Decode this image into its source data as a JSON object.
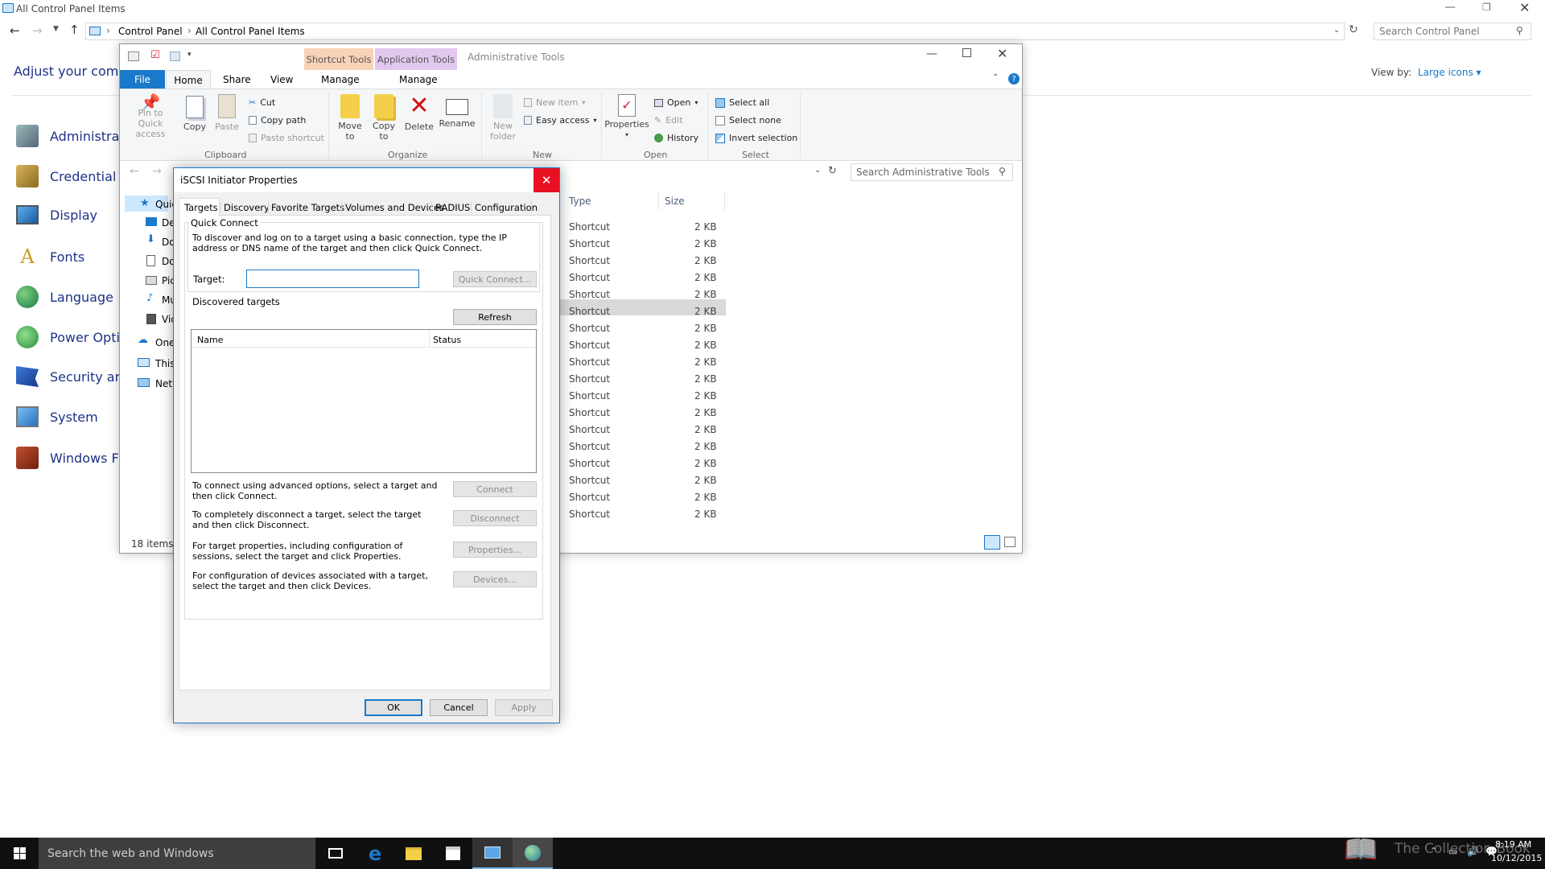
{
  "control_panel": {
    "title": "All Control Panel Items",
    "breadcrumb": [
      "Control Panel",
      "All Control Panel Items"
    ],
    "search_placeholder": "Search Control Panel",
    "adjust_text": "Adjust your compu",
    "view_by_label": "View by:",
    "view_by_value": "Large icons",
    "items": [
      "Administrati",
      "Credential M",
      "Display",
      "Fonts",
      "Language",
      "Power Optio",
      "Security and",
      "System",
      "Windows Fir"
    ]
  },
  "explorer": {
    "ctx_tabs": {
      "shortcut_tools": "Shortcut Tools",
      "application_tools": "Application Tools"
    },
    "window_title": "Administrative Tools",
    "menu_tabs": {
      "file": "File",
      "home": "Home",
      "share": "Share",
      "view": "View",
      "manage1": "Manage",
      "manage2": "Manage"
    },
    "ribbon": {
      "pin": "Pin to Quick access",
      "copy": "Copy",
      "paste": "Paste",
      "cut": "Cut",
      "copy_path": "Copy path",
      "paste_shortcut": "Paste shortcut",
      "clipboard": "Clipboard",
      "move_to": "Move to",
      "copy_to": "Copy to",
      "delete": "Delete",
      "rename": "Rename",
      "organize": "Organize",
      "new_folder": "New folder",
      "new_item": "New item",
      "easy_access": "Easy access",
      "new": "New",
      "properties": "Properties",
      "open": "Open",
      "edit": "Edit",
      "history": "History",
      "open_group": "Open",
      "select_all": "Select all",
      "select_none": "Select none",
      "invert_selection": "Invert selection",
      "select_group": "Select"
    },
    "search_placeholder": "Search Administrative Tools",
    "nav_items": [
      "Quic",
      "De",
      "Do",
      "Do",
      "Pic",
      "Mu",
      "Vic",
      "One",
      "This",
      "Netw"
    ],
    "columns": {
      "type": "Type",
      "size": "Size"
    },
    "rows": [
      {
        "type": "Shortcut",
        "size": "2 KB"
      },
      {
        "type": "Shortcut",
        "size": "2 KB"
      },
      {
        "type": "Shortcut",
        "size": "2 KB"
      },
      {
        "type": "Shortcut",
        "size": "2 KB"
      },
      {
        "type": "Shortcut",
        "size": "2 KB"
      },
      {
        "type": "Shortcut",
        "size": "2 KB"
      },
      {
        "type": "Shortcut",
        "size": "2 KB"
      },
      {
        "type": "Shortcut",
        "size": "2 KB"
      },
      {
        "type": "Shortcut",
        "size": "2 KB"
      },
      {
        "type": "Shortcut",
        "size": "2 KB"
      },
      {
        "type": "Shortcut",
        "size": "2 KB"
      },
      {
        "type": "Shortcut",
        "size": "2 KB"
      },
      {
        "type": "Shortcut",
        "size": "2 KB"
      },
      {
        "type": "Shortcut",
        "size": "2 KB"
      },
      {
        "type": "Shortcut",
        "size": "2 KB"
      },
      {
        "type": "Shortcut",
        "size": "2 KB"
      },
      {
        "type": "Shortcut",
        "size": "2 KB"
      },
      {
        "type": "Shortcut",
        "size": "2 KB"
      }
    ],
    "status": "18 items"
  },
  "dialog": {
    "title": "iSCSI Initiator Properties",
    "tabs": [
      "Targets",
      "Discovery",
      "Favorite Targets",
      "Volumes and Devices",
      "RADIUS",
      "Configuration"
    ],
    "quick_connect_label": "Quick Connect",
    "quick_connect_desc": "To discover and log on to a target using a basic connection, type the IP address or DNS name of the target and then click Quick Connect.",
    "target_label": "Target:",
    "target_value": "",
    "quick_connect_button": "Quick Connect...",
    "discovered_label": "Discovered targets",
    "refresh_button": "Refresh",
    "list_columns": {
      "name": "Name",
      "status": "Status"
    },
    "connect_desc": "To connect using advanced options, select a target and then click Connect.",
    "connect_button": "Connect",
    "disconnect_desc": "To completely disconnect a target, select the target and then click Disconnect.",
    "disconnect_button": "Disconnect",
    "properties_desc": "For target properties, including configuration of sessions, select the target and click Properties.",
    "properties_button": "Properties...",
    "devices_desc": "For configuration of devices associated with a target, select the target and then click Devices.",
    "devices_button": "Devices...",
    "ok": "OK",
    "cancel": "Cancel",
    "apply": "Apply"
  },
  "taskbar": {
    "search_placeholder": "Search the web and Windows",
    "watermark": "The Collection Book",
    "time": "8:19 AM",
    "date": "10/12/2015"
  },
  "colors": {
    "accent": "#1979ca",
    "close_red": "#e81123",
    "shortcut_tools": "#f9d3b8",
    "application_tools": "#e2c8ef",
    "link": "#1e3287",
    "taskbar": "#101010"
  }
}
